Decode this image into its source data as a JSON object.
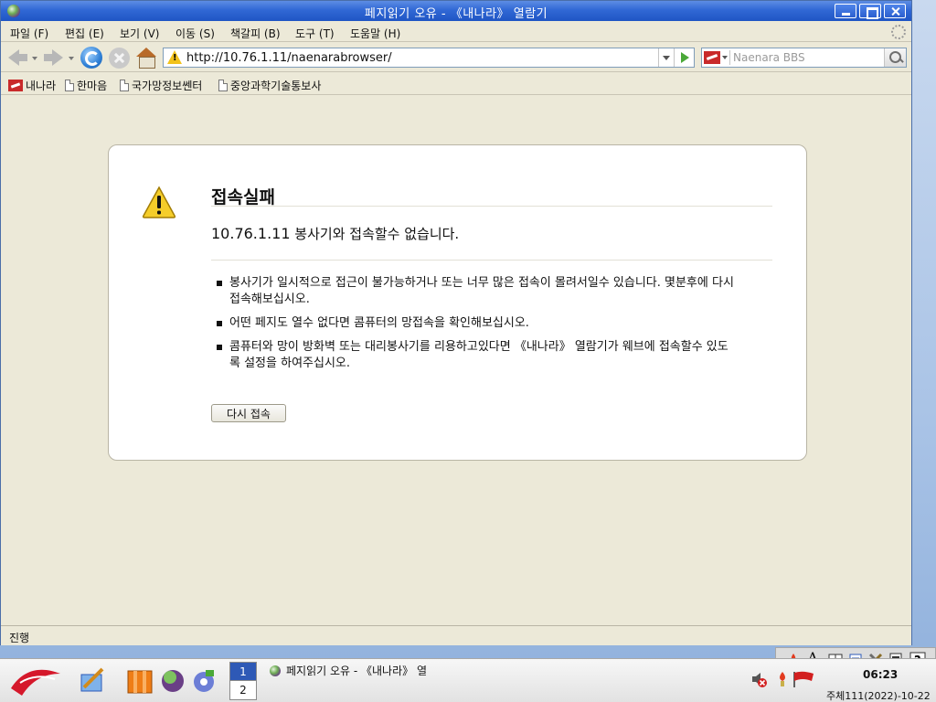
{
  "window": {
    "title": "페지읽기 오유 - 《내나라》 열람기"
  },
  "menu": [
    "파일 (F)",
    "편집 (E)",
    "보기 (V)",
    "이동 (S)",
    "책갈피 (B)",
    "도구 (T)",
    "도움말 (H)"
  ],
  "navbar": {
    "url": "http://10.76.1.11/naenarabrowser/",
    "search_placeholder": "Naenara BBS"
  },
  "bookmarks": [
    "내나라",
    "한마음",
    "국가망정보쎈터",
    "중앙과학기술통보사"
  ],
  "error": {
    "title": "접속실패",
    "ip": "10.76.1.11",
    "subtitle_rest": "봉사기와 접속할수 없습니다.",
    "bullets": [
      "봉사기가 일시적으로 접근이 불가능하거나 또는 너무 많은 접속이 몰려서일수 있습니다. 몇분후에 다시 접속해보십시오.",
      "어떤 페지도 열수 없다면 콤퓨터의 망접속을 확인해보십시오.",
      "콤퓨터와 망이 방화벽 또는 대리봉사기를 리용하고있다면 《내나라》 열람기가 웨브에 접속할수 있도록 설정을 하여주십시오."
    ],
    "retry_label": "다시 접속"
  },
  "status": "진행",
  "taskbar": {
    "pager": [
      "1",
      "2"
    ],
    "task_title": "페지읽기 오유 - 《내나라》 열",
    "time": "06:23",
    "date": "주체111(2022)-10-22"
  },
  "colors": {
    "titlebar": "#3168d5",
    "chrome": "#ece9d8",
    "warning": "#f2c21b",
    "brand_red": "#c92a2a"
  }
}
